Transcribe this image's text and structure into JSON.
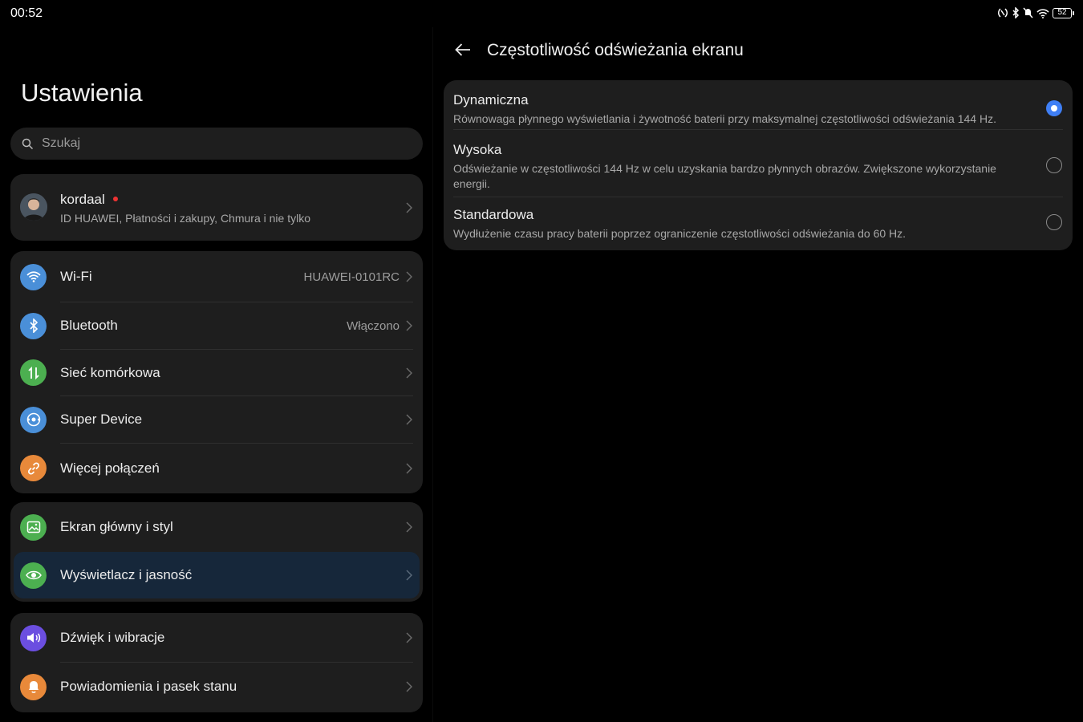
{
  "status": {
    "time": "00:52",
    "battery": "52"
  },
  "settings": {
    "title": "Ustawienia",
    "search_placeholder": "Szukaj",
    "account": {
      "name": "kordaal",
      "subtitle": "ID HUAWEI, Płatności i zakupy, Chmura i nie tylko"
    },
    "network": [
      {
        "label": "Wi-Fi",
        "value": "HUAWEI-0101RC",
        "icon": "wifi-icon",
        "color": "#4a8fd8"
      },
      {
        "label": "Bluetooth",
        "value": "Włączono",
        "icon": "bluetooth-icon",
        "color": "#4a8fd8"
      },
      {
        "label": "Sieć komórkowa",
        "value": "",
        "icon": "mobile-data-icon",
        "color": "#4caf50"
      },
      {
        "label": "Super Device",
        "value": "",
        "icon": "super-device-icon",
        "color": "#4a8fd8"
      },
      {
        "label": "Więcej połączeń",
        "value": "",
        "icon": "link-icon",
        "color": "#e8893a"
      }
    ],
    "display": [
      {
        "label": "Ekran główny i styl",
        "icon": "image-icon",
        "color": "#4caf50"
      },
      {
        "label": "Wyświetlacz i jasność",
        "icon": "eye-icon",
        "color": "#4caf50"
      }
    ],
    "sound": [
      {
        "label": "Dźwięk i wibracje",
        "icon": "speaker-icon",
        "color": "#6b4ee0"
      },
      {
        "label": "Powiadomienia i pasek stanu",
        "icon": "bell-icon",
        "color": "#e8893a"
      }
    ]
  },
  "detail": {
    "title": "Częstotliwość odświeżania ekranu",
    "accent": "#3f7ff5",
    "options": [
      {
        "title": "Dynamiczna",
        "desc": "Równowaga płynnego wyświetlania i żywotność baterii przy maksymalnej częstotliwości odświeżania 144 Hz.",
        "selected": true
      },
      {
        "title": "Wysoka",
        "desc": "Odświeżanie w częstotliwości 144 Hz w celu uzyskania bardzo płynnych obrazów. Zwiększone wykorzystanie energii.",
        "selected": false
      },
      {
        "title": "Standardowa",
        "desc": "Wydłużenie czasu pracy baterii poprzez ograniczenie częstotliwości odświeżania do 60 Hz.",
        "selected": false
      }
    ]
  }
}
